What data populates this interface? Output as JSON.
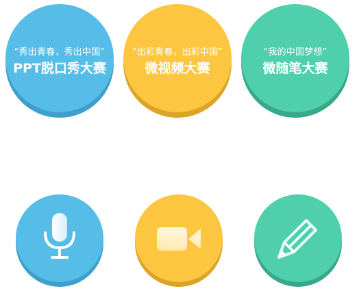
{
  "contests": [
    {
      "slogan": "“秀出青春，秀出中国”",
      "title": "PPT脱口秀大赛",
      "color": "#55bde8"
    },
    {
      "slogan": "“出彩青春，出彩中国”",
      "title": "微视频大赛",
      "color": "#fdc640"
    },
    {
      "slogan": "“我的中国梦想”",
      "title": "微随笔大赛",
      "color": "#4fcfac"
    }
  ],
  "icons": [
    {
      "icon": "microphone-icon",
      "color": "#55bde8"
    },
    {
      "icon": "video-camera-icon",
      "color": "#fdc640"
    },
    {
      "icon": "pencil-icon",
      "color": "#4fcfac"
    }
  ]
}
